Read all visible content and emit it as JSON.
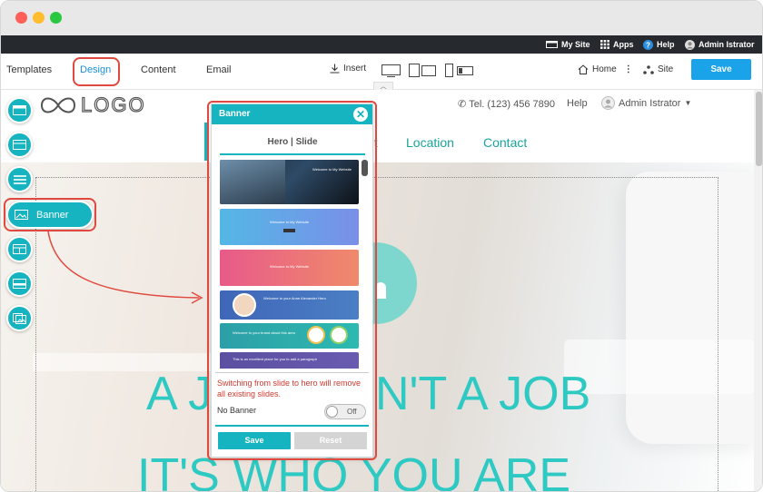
{
  "topbar": {
    "my_site": "My Site",
    "apps": "Apps",
    "help": "Help",
    "user": "Admin Istrator"
  },
  "toolbar": {
    "templates": "Templates",
    "design": "Design",
    "content": "Content",
    "email": "Email",
    "insert": "Insert",
    "home": "Home",
    "site": "Site",
    "save": "Save"
  },
  "site": {
    "logo": "LOGO",
    "phone": "Tel. (123) 456 7890",
    "help": "Help",
    "user": "Admin Istrator",
    "nav": {
      "about_partial": "ut",
      "location": "Location",
      "contact": "Contact"
    },
    "headline1_left": "A J",
    "headline1_right": "N'T A JOB",
    "headline2": "IT'S WHO YOU ARE"
  },
  "sidebar": {
    "banner_label": "Banner"
  },
  "banner_panel": {
    "title": "Banner",
    "tab": "Hero | Slide",
    "thumbs": [
      "Welcome to My Website",
      "Welcome to My Website",
      "Welcome to My Website",
      "Welcome to your Anne Alexander Hero",
      "Welcome to your brand about this area",
      "This is an excellent place for you to add a paragraph"
    ],
    "warning": "Switching from slide to hero will remove all existing slides.",
    "no_banner_label": "No Banner",
    "toggle": "Off",
    "save": "Save",
    "reset": "Reset"
  },
  "colors": {
    "accent": "#15b4c0",
    "highlight": "#e0493f",
    "headline": "#2ec9c2"
  }
}
